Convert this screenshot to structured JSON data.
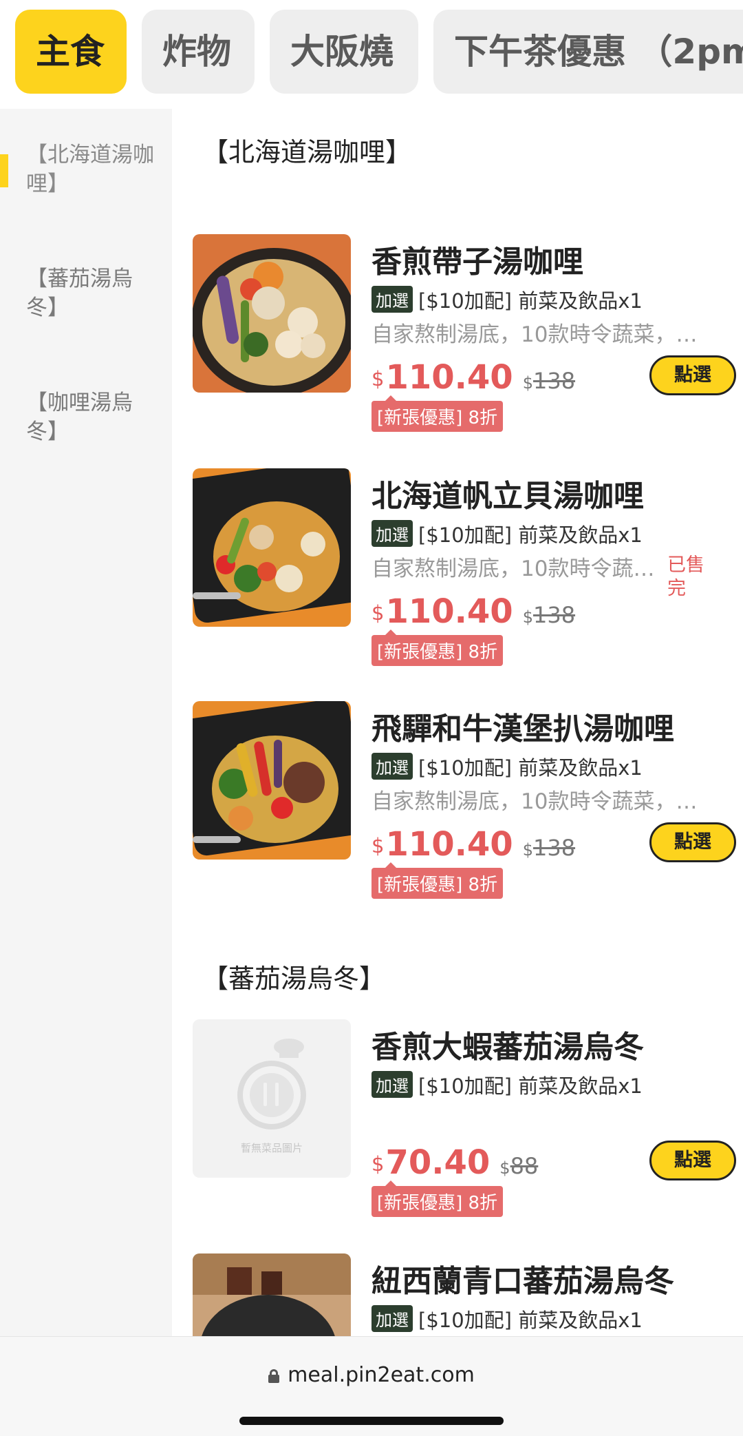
{
  "tabs": [
    "主食",
    "炸物",
    "大阪燒",
    "下午茶優惠 （2pm"
  ],
  "sidebar": {
    "items": [
      "【北海道湯咖哩】",
      "【蕃茄湯烏冬】",
      "【咖哩湯烏冬】"
    ]
  },
  "sections": [
    "【北海道湯咖哩】",
    "【蕃茄湯烏冬】"
  ],
  "items": [
    {
      "name": "香煎帶子湯咖哩",
      "addon_badge": "加選",
      "addon_text": "[$10加配] 前菜及飲品x1",
      "desc": "自家熬制湯底，10款時令蔬菜，…",
      "currency": "$",
      "price": "110.40",
      "orig_currency": "$",
      "orig_price": "138",
      "promo": "[新張優惠] 8折",
      "button": "點選"
    },
    {
      "name": "北海道帆立貝湯咖哩",
      "addon_badge": "加選",
      "addon_text": "[$10加配] 前菜及飲品x1",
      "desc": "自家熬制湯底，10款時令蔬…",
      "currency": "$",
      "price": "110.40",
      "orig_currency": "$",
      "orig_price": "138",
      "promo": "[新張優惠] 8折",
      "soldout": "已售完"
    },
    {
      "name": "飛驒和牛漢堡扒湯咖哩",
      "addon_badge": "加選",
      "addon_text": "[$10加配] 前菜及飲品x1",
      "desc": "自家熬制湯底，10款時令蔬菜，…",
      "currency": "$",
      "price": "110.40",
      "orig_currency": "$",
      "orig_price": "138",
      "promo": "[新張優惠] 8折",
      "button": "點選"
    },
    {
      "name": "香煎大蝦蕃茄湯烏冬",
      "addon_badge": "加選",
      "addon_text": "[$10加配] 前菜及飲品x1",
      "currency": "$",
      "price": "70.40",
      "orig_currency": "$",
      "orig_price": "88",
      "promo": "[新張優惠] 8折",
      "button": "點選",
      "placeholder_text": "暫無菜品圖片"
    },
    {
      "name": "紐西蘭青口蕃茄湯烏冬",
      "addon_badge": "加選",
      "addon_text": "[$10加配] 前菜及飲品x1"
    }
  ],
  "urlbar": {
    "url": "meal.pin2eat.com"
  },
  "colors": {
    "accent": "#fdd31d",
    "price": "#e35a5a",
    "promo": "#e56b6b"
  }
}
